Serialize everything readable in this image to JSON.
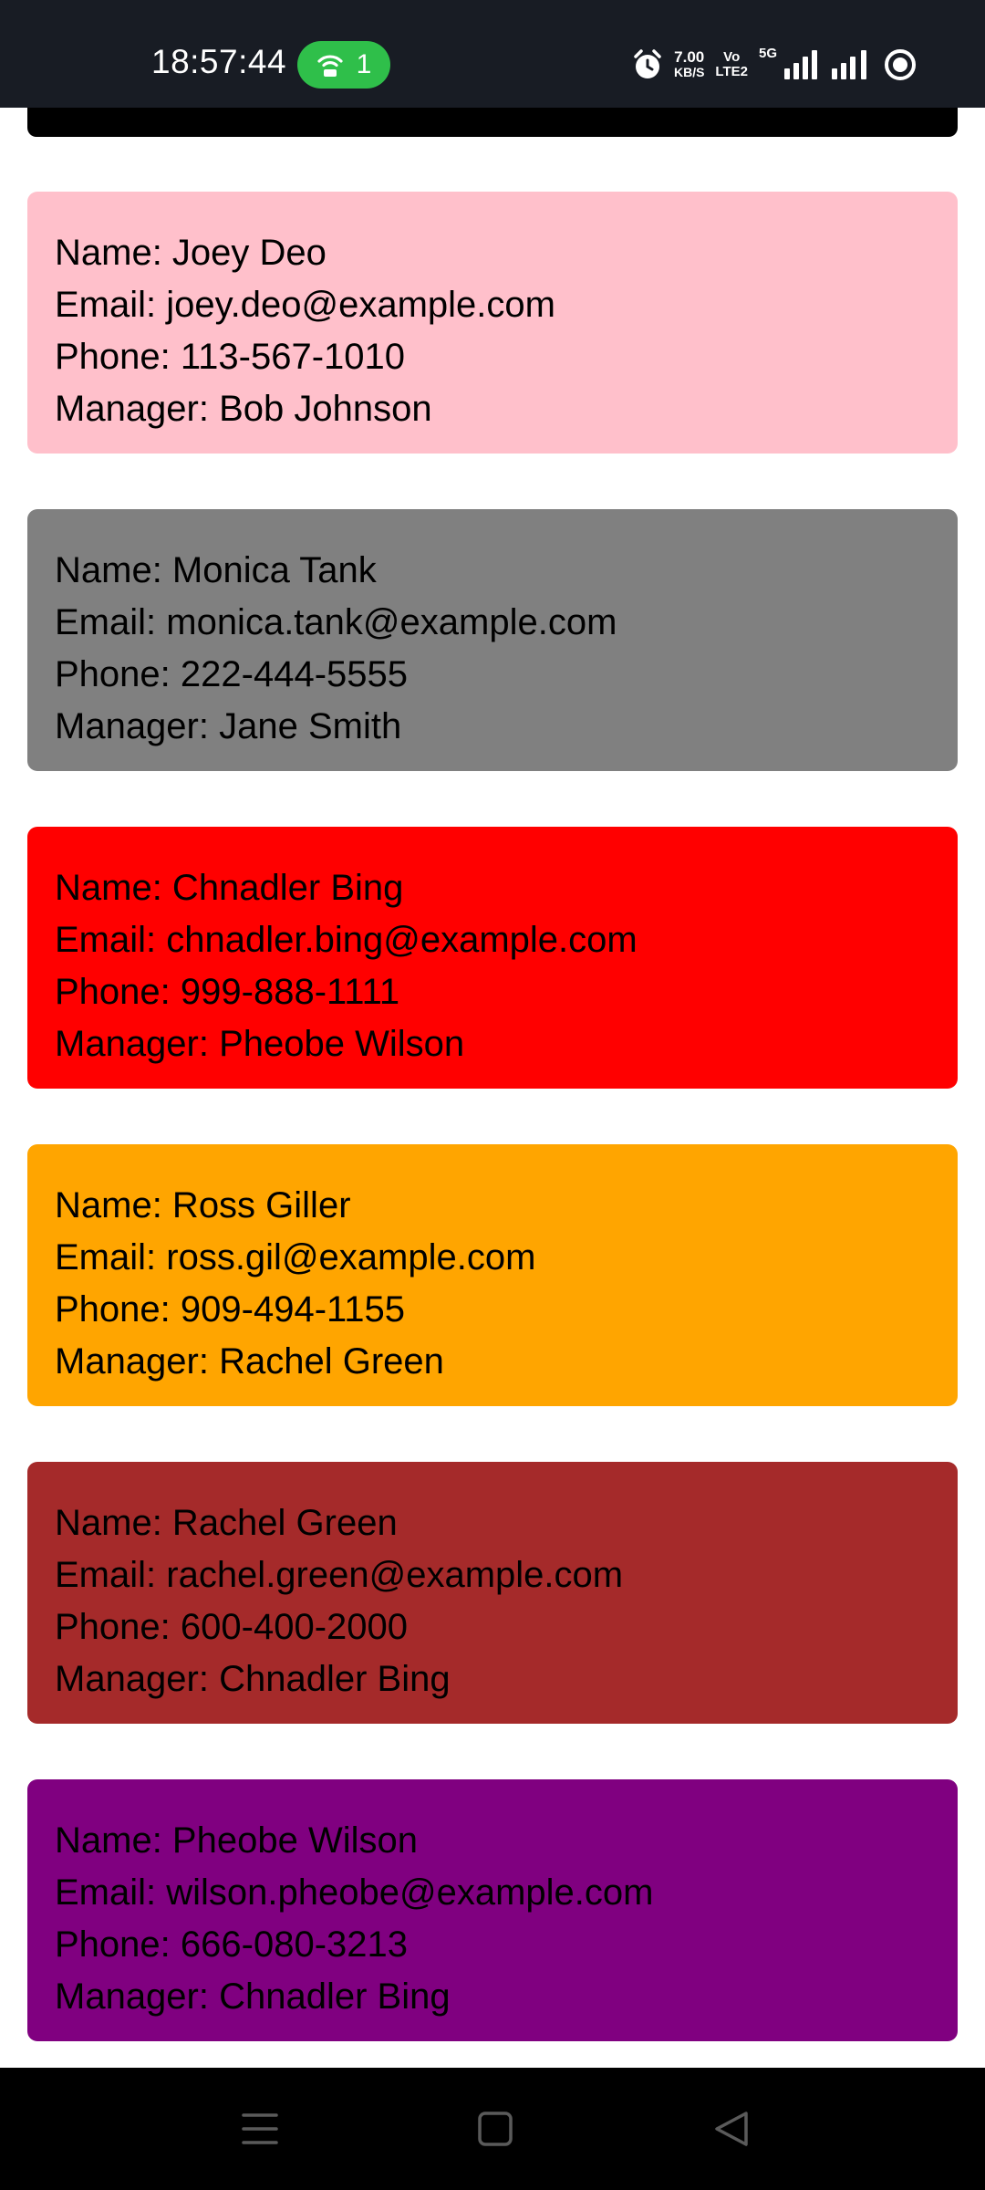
{
  "status_bar": {
    "time": "18:57:44",
    "hotspot_count": "1",
    "net_speed_value": "7.00",
    "net_speed_unit": "KB/S",
    "volte_top": "Vo",
    "volte_bottom": "LTE2",
    "network_type": "5G",
    "icons": [
      "hotspot-icon",
      "alarm-icon",
      "signal-icon",
      "signal-icon",
      "battery-ring-icon"
    ]
  },
  "contacts": [
    {
      "name_line": "Name: Joey Deo",
      "email_line": "Email: joey.deo@example.com",
      "phone_line": "Phone: 113-567-1010",
      "manager_line": "Manager: Bob Johnson",
      "color": "#ffc0cb"
    },
    {
      "name_line": "Name: Monica Tank",
      "email_line": "Email: monica.tank@example.com",
      "phone_line": "Phone: 222-444-5555",
      "manager_line": "Manager: Jane Smith",
      "color": "#808080"
    },
    {
      "name_line": "Name: Chnadler Bing",
      "email_line": "Email: chnadler.bing@example.com",
      "phone_line": "Phone: 999-888-1111",
      "manager_line": "Manager: Pheobe Wilson",
      "color": "#ff0000"
    },
    {
      "name_line": "Name: Ross Giller",
      "email_line": "Email: ross.gil@example.com",
      "phone_line": "Phone: 909-494-1155",
      "manager_line": "Manager: Rachel Green",
      "color": "#ffa500"
    },
    {
      "name_line": "Name: Rachel Green",
      "email_line": "Email: rachel.green@example.com",
      "phone_line": "Phone: 600-400-2000",
      "manager_line": "Manager: Chnadler Bing",
      "color": "#a52a2a"
    },
    {
      "name_line": "Name: Pheobe Wilson",
      "email_line": "Email: wilson.pheobe@example.com",
      "phone_line": "Phone: 666-080-3213",
      "manager_line": "Manager: Chnadler Bing",
      "color": "#800080"
    }
  ],
  "colors": {
    "status_bar_bg": "#181c24",
    "hotspot_pill": "#2fbf4a",
    "nav_bar_bg": "#000000"
  },
  "nav_bar": {
    "icons": [
      "menu-icon",
      "home-icon",
      "back-icon"
    ]
  }
}
